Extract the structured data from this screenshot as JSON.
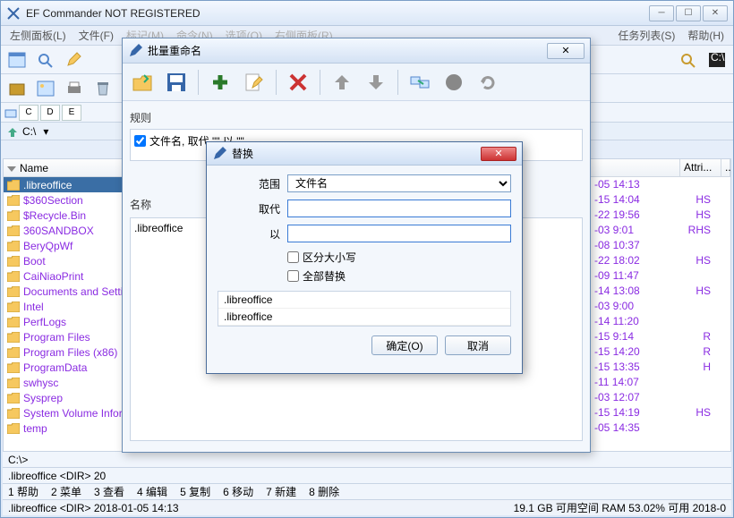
{
  "main": {
    "title": "EF Commander NOT REGISTERED",
    "menu": [
      "左侧面板(L)",
      "文件(F)",
      "标记(M)",
      "命令(N)",
      "选项(O)",
      "右侧面板(R)",
      "任务列表(S)",
      "帮助(H)"
    ],
    "drives": [
      "C",
      "D",
      "E"
    ],
    "path": "C:\\",
    "name_col": "Name",
    "attri_col": "Attri...",
    "files": [
      ".libreoffice",
      "$360Section",
      "$Recycle.Bin",
      "360SANDBOX",
      "BeryQpWf",
      "Boot",
      "CaiNiaoPrint",
      "Documents and Settin",
      "Intel",
      "PerfLogs",
      "Program Files",
      "Program Files (x86)",
      "ProgramData",
      "swhysc",
      "Sysprep",
      "System Volume Inform",
      "temp"
    ],
    "right_rows": [
      {
        "dt": "-05  14:13",
        "at": ""
      },
      {
        "dt": "-15  14:04",
        "at": "HS"
      },
      {
        "dt": "-22  19:56",
        "at": "HS"
      },
      {
        "dt": "-03  9:01",
        "at": "RHS"
      },
      {
        "dt": "-08  10:37",
        "at": ""
      },
      {
        "dt": "-22  18:02",
        "at": "HS"
      },
      {
        "dt": "-09  11:47",
        "at": ""
      },
      {
        "dt": "-14  13:08",
        "at": "HS"
      },
      {
        "dt": "-03  9:00",
        "at": ""
      },
      {
        "dt": "-14  11:20",
        "at": ""
      },
      {
        "dt": "-15  9:14",
        "at": "R"
      },
      {
        "dt": "-15  14:20",
        "at": "R"
      },
      {
        "dt": "-15  13:35",
        "at": "H"
      },
      {
        "dt": "-11  14:07",
        "at": ""
      },
      {
        "dt": "-03  12:07",
        "at": ""
      },
      {
        "dt": "-15  14:19",
        "at": "HS"
      },
      {
        "dt": "-05  14:35",
        "at": ""
      }
    ],
    "status_sel": ".libreoffice   <DIR>   20",
    "cmd_prompt": "C:\\>",
    "help_items": [
      "1 帮助",
      "2 菜单",
      "3 查看",
      "4 编辑",
      "5 复制",
      "6 移动",
      "7 新建",
      "8 删除"
    ],
    "status_line": ".libreoffice    <DIR>    2018-01-05  14:13",
    "disk_info": "19.1 GB 可用空间    RAM 53.02% 可用 2018-0"
  },
  "rename": {
    "title": "批量重命名",
    "rules_label": "规则",
    "rule_text": "文件名, 取代 \"\" 以 \"\"",
    "name_label": "名称",
    "preview_item": ".libreoffice"
  },
  "replace": {
    "title": "替换",
    "scope_label": "范围",
    "scope_value": "文件名",
    "find_label": "取代",
    "with_label": "以",
    "case_label": "区分大小写",
    "all_label": "全部替换",
    "preview1": ".libreoffice",
    "preview2": ".libreoffice",
    "ok": "确定(O)",
    "cancel": "取消"
  }
}
